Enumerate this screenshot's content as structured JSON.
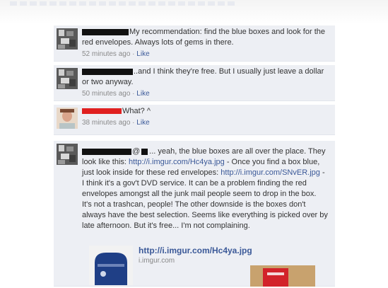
{
  "comments": [
    {
      "text": "My recommendation: find the blue boxes and look for the red envelopes. Always lots of gems in there.",
      "time": "52 minutes ago",
      "like": "Like",
      "separator": " · "
    },
    {
      "text": "..and I think they're free. But I usually just leave a dollar or two anyway.",
      "time": "50 minutes ago",
      "like": "Like",
      "separator": " · "
    },
    {
      "text": "What? ^",
      "time": "38 minutes ago",
      "like": "Like",
      "separator": " · "
    }
  ],
  "reply": {
    "mention_prefix": "@",
    "text_1": "... yeah, the blue boxes are all over the place. They look like this: ",
    "link_1": "http://i.imgur.com/Hc4ya.jpg",
    "text_2": " - Once you find a box blue, just look inside for these red envelopes: ",
    "link_2": "http://i.imgur.com/SNvER.jpg",
    "text_3": " - I think it's a gov't DVD service. It can be a problem finding the red envelopes amongst all the junk mail people seem to drop in the box. It's not a trashcan, people! The other downside is the boxes don't always have the best selection. Seems like everything is picked over by late afternoon. But it's free... I'm not complaining.",
    "attachment": {
      "title": "http://i.imgur.com/Hc4ya.jpg",
      "domain": "i.imgur.com"
    }
  },
  "colors": {
    "comment_bg": "#edeff4",
    "link": "#3b5998",
    "redaction_black": "#111111",
    "redaction_red": "#e02020"
  }
}
